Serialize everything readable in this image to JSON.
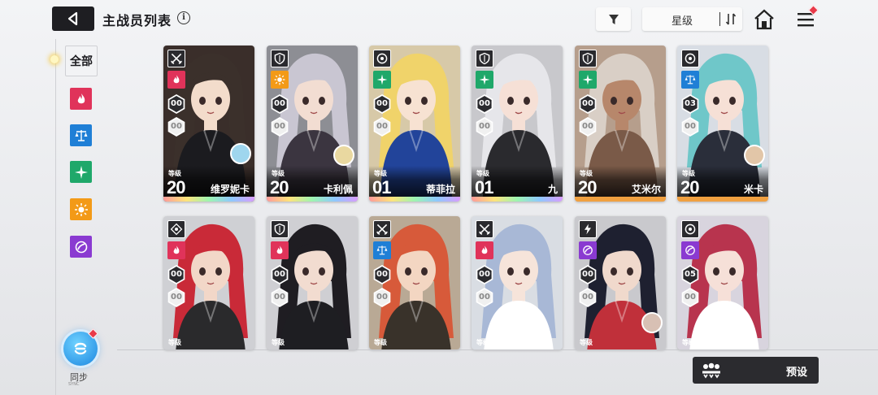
{
  "header": {
    "title": "主战员列表",
    "info_icon": "info-icon",
    "sort_label": "星级"
  },
  "sidebar": {
    "all_label": "全部",
    "filters": [
      {
        "name": "fire",
        "color": "#e0335a"
      },
      {
        "name": "order",
        "color": "#1f7fd6"
      },
      {
        "name": "wind",
        "color": "#1fa86a"
      },
      {
        "name": "light",
        "color": "#f39a17"
      },
      {
        "name": "void",
        "color": "#8a3ad1"
      }
    ],
    "sync_label": "同步",
    "sync_sub": "SYNC"
  },
  "cards": [
    {
      "name": "维罗妮卡",
      "level_label": "等级",
      "level": "20",
      "class_icon": "blades-icon",
      "element": "#e0335a",
      "hex_top": "00",
      "hex_bot": "00",
      "rarity": "ssr"
    },
    {
      "name": "卡利佩",
      "level_label": "等级",
      "level": "20",
      "class_icon": "shield-icon",
      "element": "#f39a17",
      "hex_top": "00",
      "hex_bot": "00",
      "rarity": "ssr"
    },
    {
      "name": "蒂菲拉",
      "level_label": "等级",
      "level": "01",
      "class_icon": "target-icon",
      "element": "#1fa86a",
      "hex_top": "00",
      "hex_bot": "00",
      "rarity": "ssr"
    },
    {
      "name": "九",
      "level_label": "等级",
      "level": "01",
      "class_icon": "shield-icon",
      "element": "#1fa86a",
      "hex_top": "00",
      "hex_bot": "00",
      "rarity": "ssr"
    },
    {
      "name": "艾米尔",
      "level_label": "等级",
      "level": "20",
      "class_icon": "shield-icon",
      "element": "#1fa86a",
      "hex_top": "00",
      "hex_bot": "00",
      "rarity": "sr"
    },
    {
      "name": "米卡",
      "level_label": "等级",
      "level": "20",
      "class_icon": "target-icon",
      "element": "#1f7fd6",
      "hex_top": "03",
      "hex_bot": "00",
      "rarity": "sr"
    },
    {
      "level_label": "等级",
      "class_icon": "crosshair-icon",
      "element": "#e0335a",
      "hex_top": "00",
      "hex_bot": "00"
    },
    {
      "level_label": "等级",
      "class_icon": "shield-icon",
      "element": "#e0335a",
      "hex_top": "00",
      "hex_bot": "00"
    },
    {
      "level_label": "等级",
      "class_icon": "blades-icon",
      "element": "#1f7fd6",
      "hex_top": "00",
      "hex_bot": "00"
    },
    {
      "level_label": "等级",
      "class_icon": "blades-icon",
      "element": "#e0335a",
      "hex_top": "00",
      "hex_bot": "00"
    },
    {
      "level_label": "等级",
      "class_icon": "bolt-icon",
      "element": "#8a3ad1",
      "hex_top": "00",
      "hex_bot": "00"
    },
    {
      "level_label": "等级",
      "class_icon": "target-icon",
      "element": "#8a3ad1",
      "hex_top": "05",
      "hex_bot": "00"
    }
  ],
  "preset": {
    "label": "预设"
  }
}
